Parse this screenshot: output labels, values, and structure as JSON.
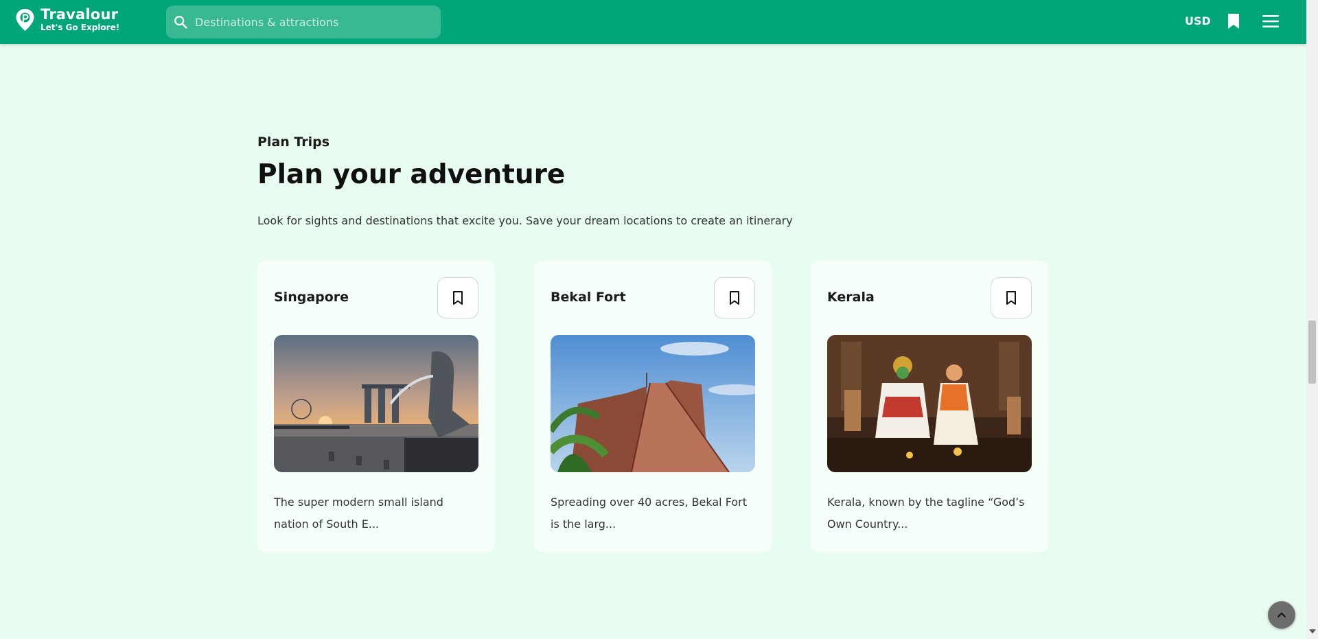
{
  "header": {
    "brand_name": "Travalour",
    "brand_tagline": "Let's Go Explore!",
    "search_placeholder": "Destinations & attractions",
    "currency": "USD",
    "icons": [
      "logo-pin-icon",
      "search-icon",
      "bookmark-icon",
      "hamburger-menu-icon"
    ]
  },
  "section": {
    "eyebrow": "Plan Trips",
    "title": "Plan your adventure",
    "description": "Look for sights and destinations that excite you. Save your dream locations to create an itinerary"
  },
  "cards": [
    {
      "title": "Singapore",
      "description": "The super modern small island nation of South E..."
    },
    {
      "title": "Bekal Fort",
      "description": "Spreading over 40 acres, Bekal Fort is the larg..."
    },
    {
      "title": "Kerala",
      "description": "Kerala, known by the tagline “God’s Own Country..."
    }
  ],
  "colors": {
    "brand_green": "#00a677",
    "page_background": "#e9fcf2",
    "card_background": "#f6fffa"
  }
}
